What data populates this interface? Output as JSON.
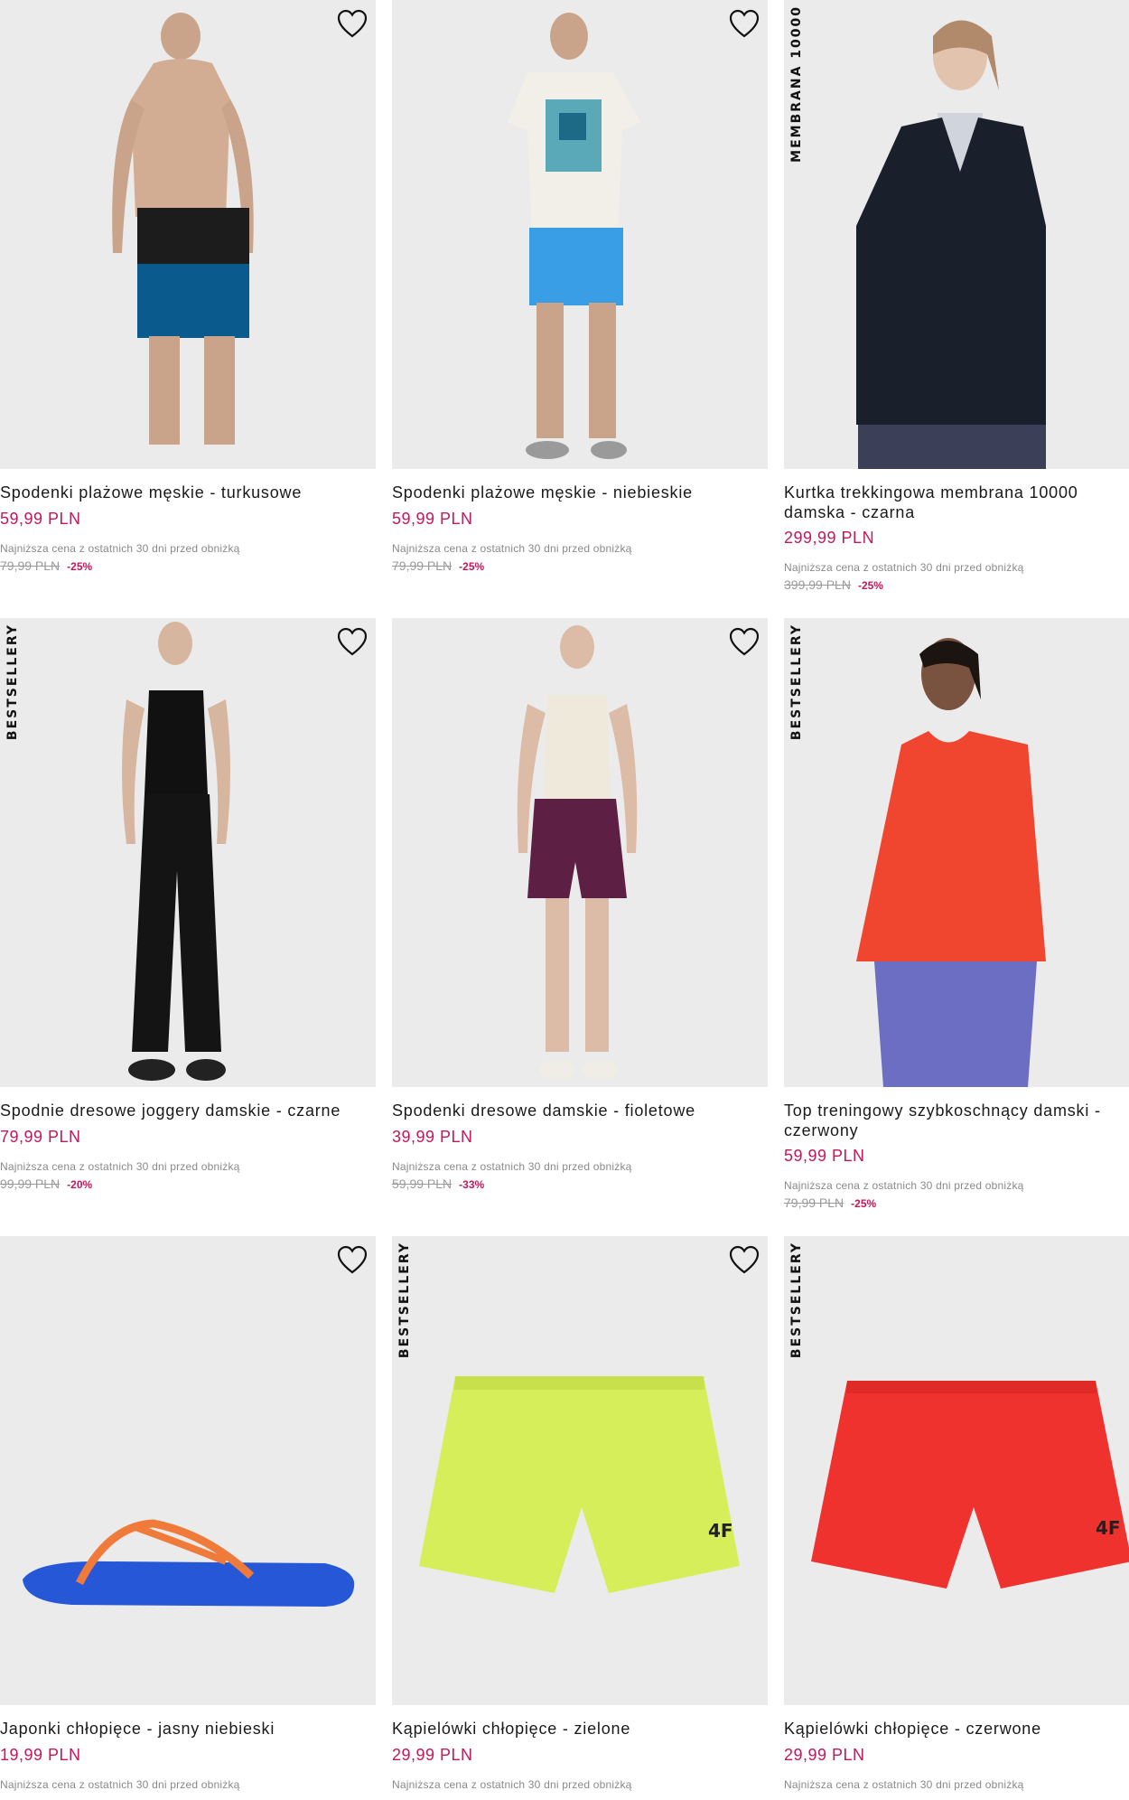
{
  "lowest_price_note": "Najniższa cena z ostatnich 30 dni przed obniżką",
  "colors": {
    "price": "#c2185b",
    "image_bg": "#ebebeb",
    "text": "#1a1a1a"
  },
  "products": [
    {
      "title": "Spodenki plażowe męskie - turkusowe",
      "price": "59,99 PLN",
      "old_price": "79,99 PLN",
      "discount": "-25%",
      "badge": ""
    },
    {
      "title": "Spodenki plażowe męskie - niebieskie",
      "price": "59,99 PLN",
      "old_price": "79,99 PLN",
      "discount": "-25%",
      "badge": ""
    },
    {
      "title": "Kurtka trekkingowa membrana 10000 damska - czarna",
      "price": "299,99 PLN",
      "old_price": "399,99 PLN",
      "discount": "-25%",
      "badge": "MEMBRANA 10000"
    },
    {
      "title": "Spodnie dresowe joggery damskie - czarne",
      "price": "79,99 PLN",
      "old_price": "99,99 PLN",
      "discount": "-20%",
      "badge": "BESTSELLERY"
    },
    {
      "title": "Spodenki dresowe damskie - fioletowe",
      "price": "39,99 PLN",
      "old_price": "59,99 PLN",
      "discount": "-33%",
      "badge": ""
    },
    {
      "title": "Top treningowy szybkoschnący damski - czerwony",
      "price": "59,99 PLN",
      "old_price": "79,99 PLN",
      "discount": "-25%",
      "badge": "BESTSELLERY"
    },
    {
      "title": "Japonki chłopięce - jasny niebieski",
      "price": "19,99 PLN",
      "badge": ""
    },
    {
      "title": "Kąpielówki chłopięce - zielone",
      "price": "29,99 PLN",
      "badge": "BESTSELLERY"
    },
    {
      "title": "Kąpielówki chłopięce - czerwone",
      "price": "29,99 PLN",
      "badge": "BESTSELLERY"
    }
  ]
}
